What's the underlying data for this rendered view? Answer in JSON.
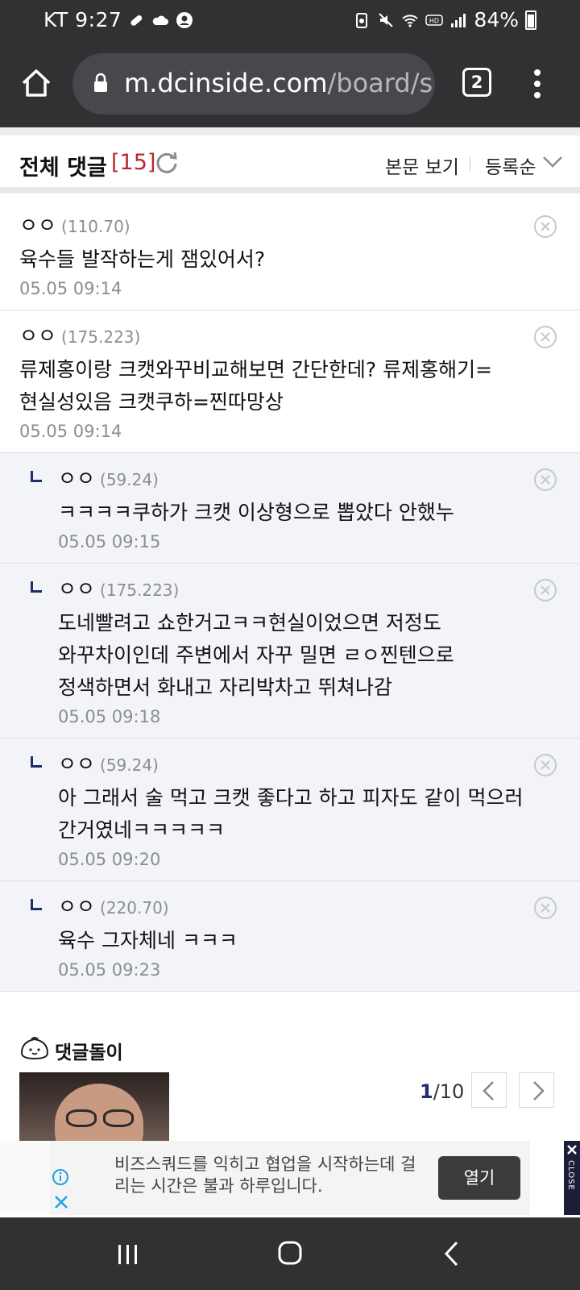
{
  "status_bar": {
    "carrier_time": "KT 9:27",
    "battery": "84%",
    "left_icons": [
      "pill-icon",
      "cloud-icon",
      "account-icon"
    ],
    "right_icons": [
      "battery-saver-icon",
      "mute-icon",
      "wifi-icon",
      "hd-icon",
      "signal-icon"
    ]
  },
  "browser": {
    "url_host": "m.dcinside.com",
    "url_path": "/board/s",
    "tab_count": "2"
  },
  "comments_header": {
    "title": "전체 댓글",
    "count": "[15]",
    "view_body": "본문 보기",
    "sort": "등록순"
  },
  "comments": [
    {
      "nick": "ㅇㅇ",
      "ip": "(110.70)",
      "text": "육수들 발작하는게 잼있어서?",
      "date": "05.05 09:14",
      "reply": false
    },
    {
      "nick": "ㅇㅇ",
      "ip": "(175.223)",
      "text": "류제홍이랑 크캣와꾸비교해보면 간단한데? 류제홍해기=현실성있음 크캣쿠하=찐따망상",
      "date": "05.05 09:14",
      "reply": false
    },
    {
      "nick": "ㅇㅇ",
      "ip": "(59.24)",
      "text": "ㅋㅋㅋㅋ쿠하가 크캣 이상형으로 뽑았다 안했누",
      "date": "05.05 09:15",
      "reply": true
    },
    {
      "nick": "ㅇㅇ",
      "ip": "(175.223)",
      "text": "도네빨려고 쇼한거고ㅋㅋ현실이었으면 저정도 와꾸차이인데 주변에서 자꾸 밀면 ㄹㅇ찐텐으로 정색하면서 화내고 자리박차고 뛰쳐나감",
      "date": "05.05 09:18",
      "reply": true
    },
    {
      "nick": "ㅇㅇ",
      "ip": "(59.24)",
      "text": "아 그래서 술 먹고 크캣 좋다고 하고 피자도 같이 먹으러 간거였네ㅋㅋㅋㅋㅋ",
      "date": "05.05 09:20",
      "reply": true
    },
    {
      "nick": "ㅇㅇ",
      "ip": "(220.70)",
      "text": "육수 그자체네 ㅋㅋㅋ",
      "date": "05.05 09:23",
      "reply": true
    }
  ],
  "comment_bot": {
    "title": "댓글돌이",
    "page_current": "1",
    "page_total": "/10"
  },
  "ad": {
    "text": "비즈스쿼드를 익히고 협업을 시작하는데 걸리는 시간은 불과 하루입니다.",
    "button": "열기",
    "close_label": "CLOSE"
  },
  "colors": {
    "chrome_bg": "#303133",
    "comment_count": "#b8292f",
    "reply_bg": "#f2f4f8",
    "accent_navy": "#1e2d6b"
  }
}
